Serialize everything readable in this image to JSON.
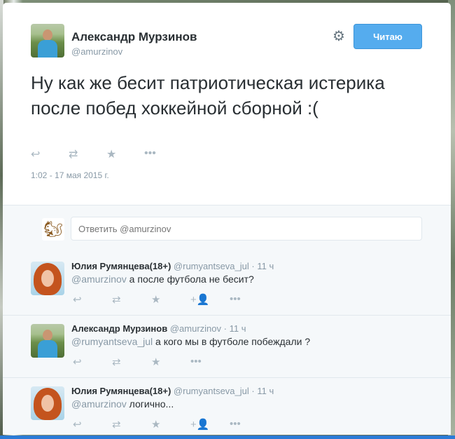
{
  "tweet": {
    "author_name": "Александр Мурзинов",
    "author_handle": "@amurzinov",
    "follow_label": "Читаю",
    "text": "Ну как же бесит патриотическая истерика после побед хоккейной сборной :(",
    "timestamp": "1:02 - 17 мая 2015 г."
  },
  "reply_box": {
    "placeholder": "Ответить @amurzinov"
  },
  "replies": [
    {
      "name": "Юлия Румянцева(18+)",
      "handle": "@rumyantseva_jul",
      "time": "· 11 ч",
      "mention": "@amurzinov",
      "text": " а после футбола не бесит?"
    },
    {
      "name": "Александр Мурзинов",
      "handle": "@amurzinov",
      "time": "· 11 ч",
      "mention": "@rumyantseva_jul",
      "text": " а кого мы в футболе побеждали ?"
    },
    {
      "name": "Юлия Румянцева(18+)",
      "handle": "@rumyantseva_jul",
      "time": "· 11 ч",
      "mention": "@amurzinov",
      "text": " логично..."
    }
  ],
  "icons": {
    "reply": "↩",
    "retweet": "⇄",
    "favorite": "★",
    "more": "•••",
    "follow_user": "+👤",
    "gear": "⚙"
  },
  "colors": {
    "accent": "#55acee",
    "text": "#292f33",
    "muted": "#8899a6"
  }
}
